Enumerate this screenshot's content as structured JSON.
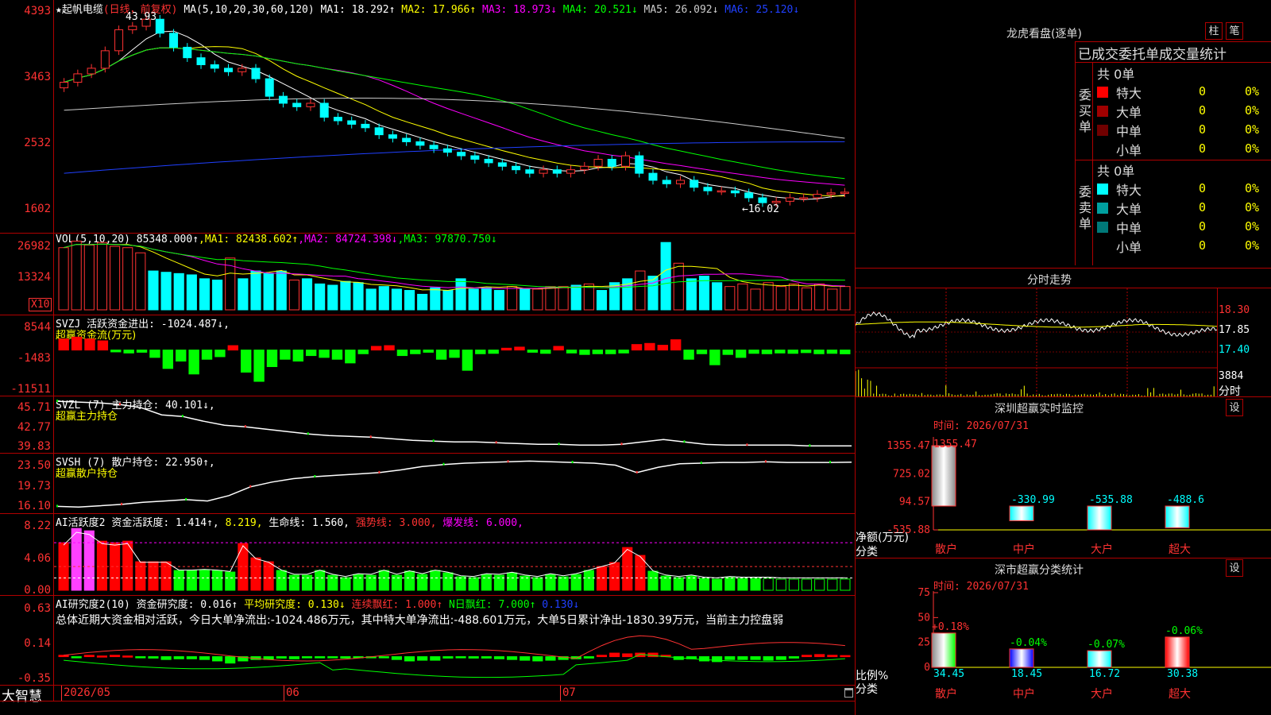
{
  "stock": {
    "name": "★起帆电缆",
    "mode": "(日线，前复权)",
    "ma_label": "MA(5,10,20,30,60,120)",
    "ma": [
      {
        "label": "MA1:",
        "value": "18.292",
        "arrow": "↑",
        "color": "#ffffff"
      },
      {
        "label": "MA2:",
        "value": "17.966",
        "arrow": "↑",
        "color": "#ffff00"
      },
      {
        "label": "MA3:",
        "value": "18.973",
        "arrow": "↓",
        "color": "#ff00ff"
      },
      {
        "label": "MA4:",
        "value": "20.521",
        "arrow": "↓",
        "color": "#00ff00"
      },
      {
        "label": "MA5:",
        "value": "26.092",
        "arrow": "↓",
        "color": "#cccccc"
      },
      {
        "label": "MA6:",
        "value": "25.120",
        "arrow": "↓",
        "color": "#2040ff"
      }
    ],
    "high_mark": "43.93",
    "low_mark": "←16.02",
    "y_ticks": [
      "4393",
      "3463",
      "2532",
      "1602"
    ]
  },
  "vol": {
    "label": "VOL(5,10,20)",
    "value": "85348.000↑",
    "ma": [
      {
        "label": "MA1:",
        "value": "82438.602↑",
        "color": "#ffff00"
      },
      {
        "label": "MA2:",
        "value": "84724.398↓",
        "color": "#ff00ff"
      },
      {
        "label": "MA3:",
        "value": "97870.750↓",
        "color": "#00ff00"
      }
    ],
    "y_ticks": [
      "26982",
      "13324"
    ],
    "unit": "X10"
  },
  "svzj": {
    "label": "SVZJ",
    "title": "活跃资金进出:",
    "value": "-1024.487↓,",
    "sub": "超赢资金流(万元)",
    "y_ticks": [
      "8544",
      "-1483",
      "-11511"
    ]
  },
  "svzl": {
    "label": "SVZL (7)",
    "title": "主力持仓:",
    "value": "40.101↓,",
    "sub": "超赢主力持仓",
    "y_ticks": [
      "45.71",
      "42.77",
      "39.83"
    ]
  },
  "svsh": {
    "label": "SVSH (7)",
    "title": "散户持仓:",
    "value": "22.950↑,",
    "sub": "超赢散户持仓",
    "y_ticks": [
      "23.50",
      "19.73",
      "16.10"
    ]
  },
  "ai_active": {
    "label": "AI活跃度2",
    "items": [
      {
        "t": "资金活跃度:",
        "v": "1.414↑,",
        "color": "#ffffff"
      },
      {
        "t": "",
        "v": "8.219,",
        "color": "#ffff00"
      },
      {
        "t": "生命线:",
        "v": "1.560,",
        "color": "#ffffff"
      },
      {
        "t": "强势线:",
        "v": "3.000,",
        "color": "#ff3232"
      },
      {
        "t": "爆发线:",
        "v": "6.000,",
        "color": "#ff00ff"
      }
    ],
    "y_ticks": [
      "8.22",
      "4.06",
      "0.00"
    ]
  },
  "ai_research": {
    "label": "AI研究度2(10)",
    "items": [
      {
        "t": "资金研究度:",
        "v": "0.016↑",
        "color": "#ffffff"
      },
      {
        "t": "平均研究度:",
        "v": "0.130↓",
        "color": "#ffff00"
      },
      {
        "t": "连续飘红:",
        "v": "1.000↑",
        "color": "#ff3232"
      },
      {
        "t": "N日飘红:",
        "v": "7.000↑",
        "color": "#00ff00"
      },
      {
        "t": "",
        "v": "0.130↓",
        "color": "#2040ff"
      }
    ],
    "summary": "总体近期大资金相对活跃，今日大单净流出:-1024.486万元，其中特大单净流出:-488.601万元，大单5日累计净出-1830.39万元，当前主力控盘弱",
    "y_ticks": [
      "0.63",
      "0.14",
      "-0.35"
    ]
  },
  "bottom": {
    "brand": "大智慧",
    "dates": [
      "2026/05",
      "06",
      "07"
    ]
  },
  "right": {
    "lhb_title": "龙虎看盘(逐单)",
    "btn_zhu": "柱",
    "btn_bi": "笔",
    "tabs_title": "已成交委托单成交量统计",
    "buy": {
      "side": "委买单",
      "total": "共 0单",
      "rows": [
        {
          "name": "特大",
          "count": "0",
          "pct": "0%",
          "color": "#ff0000"
        },
        {
          "name": "大单",
          "count": "0",
          "pct": "0%",
          "color": "#a00000"
        },
        {
          "name": "中单",
          "count": "0",
          "pct": "0%",
          "color": "#700000"
        },
        {
          "name": "小单",
          "count": "0",
          "pct": "0%",
          "color": "#000000"
        }
      ]
    },
    "sell": {
      "side": "委卖单",
      "total": "共 0单",
      "rows": [
        {
          "name": "特大",
          "count": "0",
          "pct": "0%",
          "color": "#00ffff"
        },
        {
          "name": "大单",
          "count": "0",
          "pct": "0%",
          "color": "#00a0a0"
        },
        {
          "name": "中单",
          "count": "0",
          "pct": "0%",
          "color": "#007878"
        },
        {
          "name": "小单",
          "count": "0",
          "pct": "0%",
          "color": "#000000"
        }
      ]
    },
    "intraday": {
      "title": "分时走势",
      "y_ticks": [
        "18.30",
        "17.85",
        "17.40"
      ],
      "vol_tick": "3884",
      "vol_label": "分时"
    },
    "monitor": {
      "title": "深圳超赢实时监控",
      "btn": "设",
      "time": "时间: 2026/07/31",
      "y_ticks": [
        "1355.47",
        "725.02",
        "94.57",
        "-535.88"
      ],
      "ylabel": "净额(万元)",
      "xlabel": "分类",
      "categories": [
        "散户",
        "中户",
        "大户",
        "超大"
      ],
      "values": [
        1355.47,
        -330.99,
        -535.88,
        -488.6
      ],
      "value_labels": [
        "1355.47",
        "-330.99",
        "-535.88",
        "-488.6"
      ]
    },
    "classify": {
      "title": "深市超赢分类统计",
      "btn": "设",
      "time": "时间: 2026/07/31",
      "y_ticks": [
        "75",
        "50",
        "25",
        "0"
      ],
      "ylabel": "比例%",
      "xlabel": "分类",
      "categories": [
        "散户",
        "中户",
        "大户",
        "超大"
      ],
      "values": [
        34.45,
        18.45,
        16.72,
        30.38
      ],
      "changes": [
        "+0.18%",
        "-0.04%",
        "-0.07%",
        "-0.06%"
      ],
      "value_labels": [
        "34.45",
        "18.45",
        "16.72",
        "30.38"
      ]
    }
  },
  "chart_data": [
    {
      "type": "candlestick",
      "title": "起帆电缆 日线 前复权",
      "ylim": [
        16.02,
        43.93
      ],
      "y_ticks": [
        43.93,
        34.63,
        25.32,
        16.02
      ],
      "x": [
        "2026/05",
        "06",
        "07"
      ],
      "ohlc_close": [
        34.0,
        35.2,
        36.0,
        38.5,
        41.5,
        42.0,
        43.0,
        41.0,
        39.0,
        37.5,
        36.5,
        36.0,
        35.5,
        36.0,
        34.5,
        32.0,
        31.0,
        30.5,
        31.0,
        29.0,
        28.5,
        28.0,
        27.5,
        26.5,
        26.0,
        25.5,
        25.0,
        24.5,
        24.0,
        23.5,
        23.0,
        22.5,
        22.0,
        21.5,
        21.0,
        21.5,
        21.0,
        21.5,
        22.0,
        23.0,
        22.0,
        23.5,
        21.0,
        20.0,
        19.5,
        20.0,
        19.0,
        18.5,
        18.5,
        18.2,
        17.5,
        16.8,
        17.0,
        17.5,
        17.5,
        18.0,
        18.2,
        18.3
      ],
      "series": [
        {
          "name": "MA1",
          "value": 18.292
        },
        {
          "name": "MA2",
          "value": 17.966
        },
        {
          "name": "MA3",
          "value": 18.973
        },
        {
          "name": "MA4",
          "value": 20.521
        },
        {
          "name": "MA5",
          "value": 26.092
        },
        {
          "name": "MA6",
          "value": 25.12
        }
      ]
    },
    {
      "type": "bar",
      "title": "VOL(5,10,20)",
      "unit": "X10",
      "ylim": [
        0,
        26982
      ],
      "y_ticks": [
        26982,
        13324
      ],
      "values": [
        24000,
        26500,
        25000,
        26000,
        24500,
        24000,
        22000,
        15000,
        14500,
        14000,
        13500,
        12000,
        11500,
        20000,
        12000,
        15000,
        14000,
        15000,
        11500,
        12000,
        10000,
        9500,
        11000,
        10500,
        8000,
        9000,
        8000,
        7500,
        6000,
        8500,
        7500,
        12000,
        8000,
        8500,
        7500,
        9000,
        8000,
        8000,
        9000,
        9000,
        9500,
        10000,
        7500,
        10500,
        12000,
        15000,
        13000,
        26000,
        18000,
        12000,
        13000,
        10500,
        9000,
        10000,
        8000,
        10500,
        9000,
        10000,
        8500,
        10000,
        8000,
        9000
      ]
    },
    {
      "type": "bar",
      "title": "SVZJ 活跃资金进出",
      "ylim": [
        -11511,
        8544
      ],
      "y_ticks": [
        8544,
        -1483,
        -11511
      ],
      "values": [
        3000,
        3500,
        3000,
        2500,
        -500,
        -800,
        -600,
        -2000,
        -5000,
        -3000,
        -6500,
        -2500,
        -1800,
        1200,
        -6000,
        -8500,
        -4500,
        -2500,
        -3000,
        -1500,
        -2000,
        -2500,
        -3500,
        -1000,
        1000,
        1200,
        -1500,
        -1000,
        -600,
        -2500,
        -2000,
        -5500,
        -1000,
        -900,
        500,
        800,
        -600,
        -900,
        1000,
        -800,
        -1200,
        -1000,
        -1000,
        -800,
        1500,
        1800,
        1300,
        2800,
        -2500,
        -1000,
        -4000,
        -1200,
        -2000,
        -900,
        -1000,
        -800,
        -900,
        -700,
        -1000,
        -900,
        -1024
      ]
    },
    {
      "type": "line",
      "title": "SVZL 主力持仓",
      "ylim": [
        39.83,
        45.71
      ],
      "y_ticks": [
        45.71,
        42.77,
        39.83
      ],
      "values": [
        45.7,
        45.6,
        45.5,
        45.3,
        44.9,
        44.0,
        43.8,
        43.2,
        42.7,
        42.5,
        42.2,
        41.9,
        41.6,
        41.4,
        41.3,
        41.2,
        41.0,
        40.8,
        40.7,
        40.6,
        40.6,
        40.5,
        40.4,
        40.3,
        40.3,
        40.2,
        40.2,
        40.3,
        40.6,
        40.9,
        40.6,
        40.3,
        40.2,
        40.2,
        40.2,
        40.2,
        40.1,
        40.1,
        40.101
      ]
    },
    {
      "type": "line",
      "title": "SVSH 散户持仓",
      "ylim": [
        16.1,
        23.5
      ],
      "y_ticks": [
        23.5,
        19.73,
        16.1
      ],
      "values": [
        16.4,
        16.3,
        16.5,
        16.7,
        17.0,
        17.2,
        17.4,
        17.2,
        18.0,
        19.3,
        20.0,
        20.5,
        20.8,
        21.0,
        21.2,
        21.4,
        21.8,
        22.3,
        22.6,
        22.8,
        22.9,
        23.0,
        23.1,
        23.0,
        22.9,
        22.8,
        22.5,
        21.4,
        22.2,
        22.7,
        22.8,
        22.9,
        22.9,
        23.0,
        22.9,
        22.9,
        22.9,
        22.95
      ]
    },
    {
      "type": "bar",
      "title": "AI活跃度2",
      "ylim": [
        0,
        8.22
      ],
      "y_ticks": [
        8.22,
        4.06,
        0.0
      ],
      "series": [
        {
          "name": "资金活跃度",
          "value": 1.414
        },
        {
          "name": "生命线",
          "value": 1.56
        },
        {
          "name": "强势线",
          "value": 3.0
        },
        {
          "name": "爆发线",
          "value": 6.0
        }
      ],
      "values": [
        6.0,
        7.8,
        7.5,
        6.2,
        6.0,
        6.2,
        3.6,
        3.6,
        3.6,
        2.5,
        2.5,
        2.6,
        2.5,
        2.3,
        5.9,
        4.1,
        3.6,
        2.5,
        1.9,
        1.9,
        2.5,
        1.9,
        1.6,
        2.0,
        1.9,
        2.5,
        1.9,
        2.4,
        2.0,
        2.5,
        2.2,
        1.7,
        1.6,
        2.0,
        1.9,
        2.2,
        1.8,
        1.6,
        2.0,
        1.7,
        2.0,
        2.5,
        3.0,
        3.5,
        5.4,
        4.4,
        2.4,
        1.8,
        1.6,
        1.8,
        1.5,
        1.4,
        1.6,
        1.5,
        1.5,
        1.5,
        1.4,
        1.4,
        1.4,
        1.4,
        1.4,
        1.414
      ]
    },
    {
      "type": "bar",
      "title": "AI研究度2(10)",
      "ylim": [
        -0.35,
        0.63
      ],
      "y_ticks": [
        0.63,
        0.14,
        -0.35
      ],
      "values": [
        0.02,
        0.0,
        0.02,
        0.01,
        0.02,
        0.01,
        0.0,
        -0.02,
        -0.04,
        -0.03,
        -0.03,
        -0.04,
        -0.06,
        -0.09,
        -0.06,
        -0.04,
        -0.04,
        -0.02,
        -0.03,
        -0.01,
        0.0,
        -0.01,
        -0.02,
        0.0,
        0.0,
        -0.01,
        -0.04,
        -0.06,
        -0.05,
        -0.05,
        -0.02,
        -0.01,
        -0.02,
        -0.02,
        -0.03,
        -0.04,
        -0.05,
        -0.06,
        -0.05,
        -0.04,
        -0.03,
        -0.02,
        0.02,
        0.05,
        0.04,
        0.05,
        0.05,
        0.02,
        -0.04,
        -0.03,
        -0.06,
        -0.07,
        -0.04,
        -0.04,
        -0.04,
        -0.05,
        -0.04,
        -0.02,
        0.02,
        0.03,
        0.02,
        0.016
      ]
    }
  ]
}
